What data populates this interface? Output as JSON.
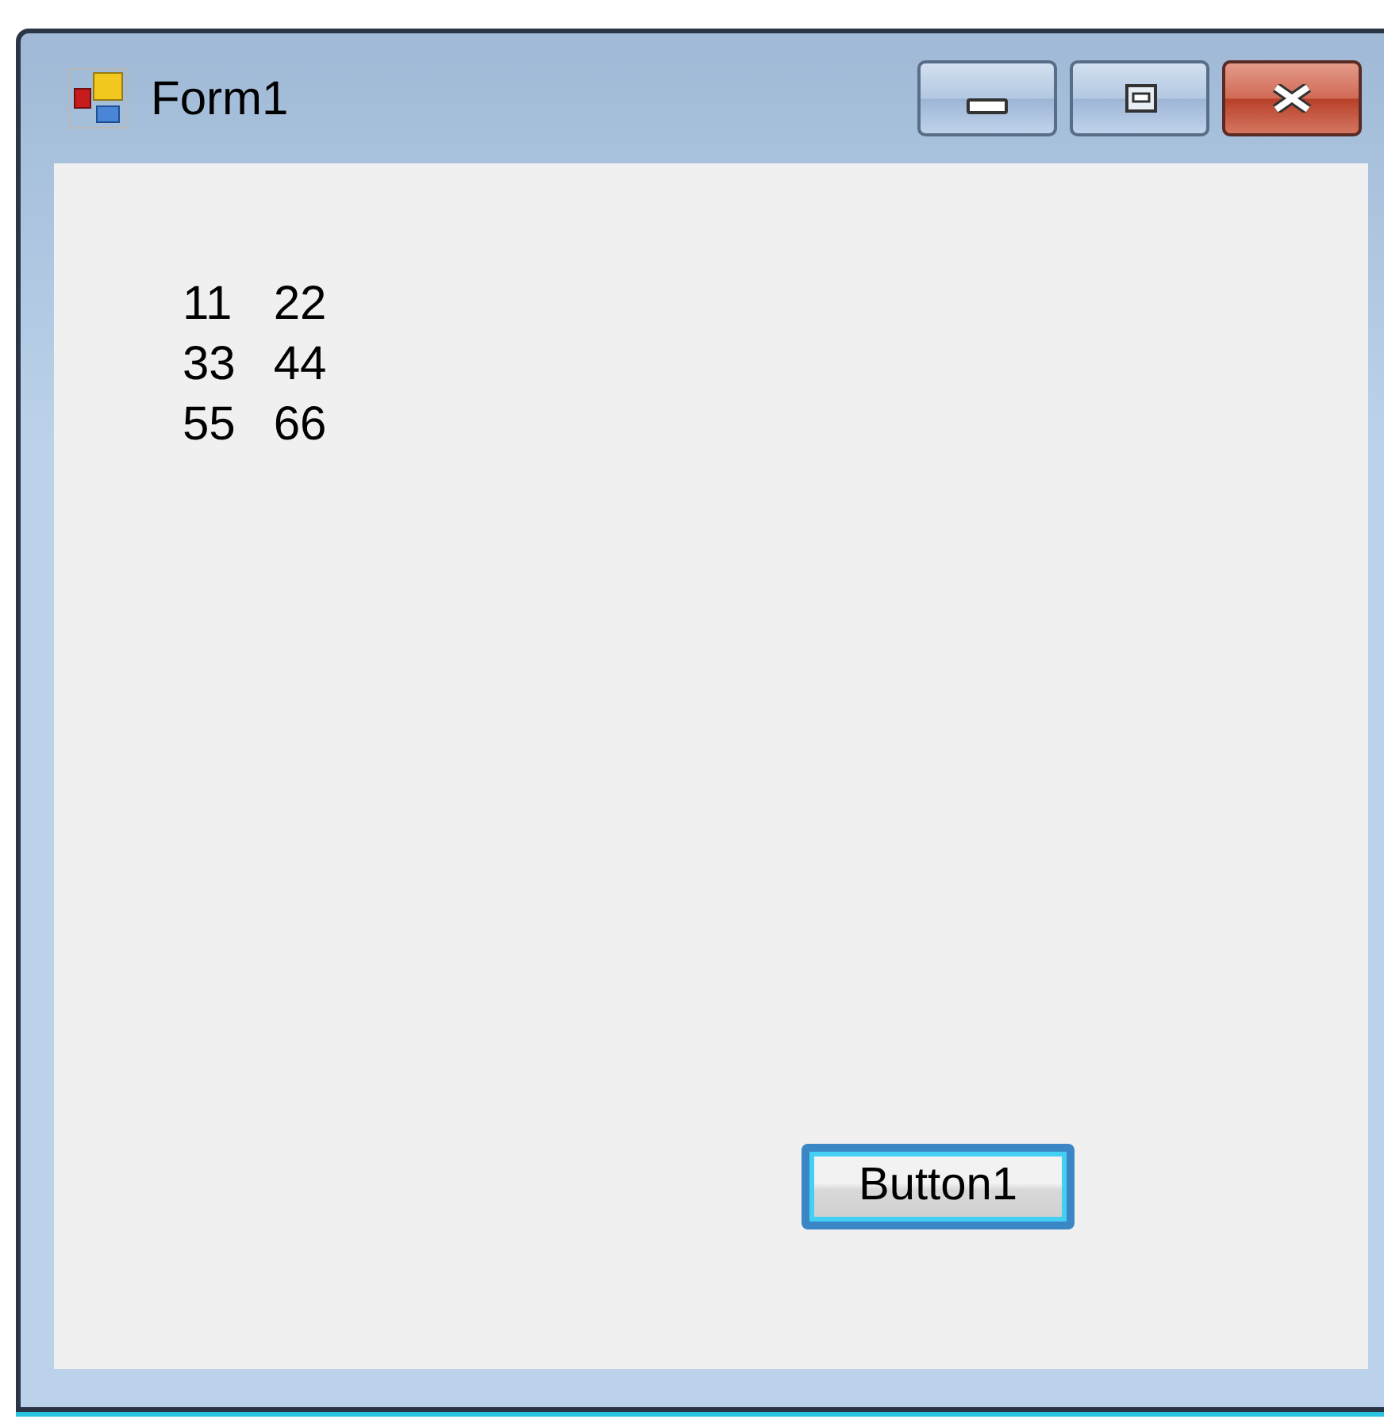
{
  "window": {
    "title": "Form1"
  },
  "title_buttons": [
    {
      "kind": "minimize"
    },
    {
      "kind": "maximize"
    },
    {
      "kind": "close"
    }
  ],
  "labels": [
    [
      "11",
      "22"
    ],
    [
      "33",
      "44"
    ],
    [
      "55",
      "66"
    ]
  ],
  "button": {
    "label": "Button1",
    "focused": true
  }
}
